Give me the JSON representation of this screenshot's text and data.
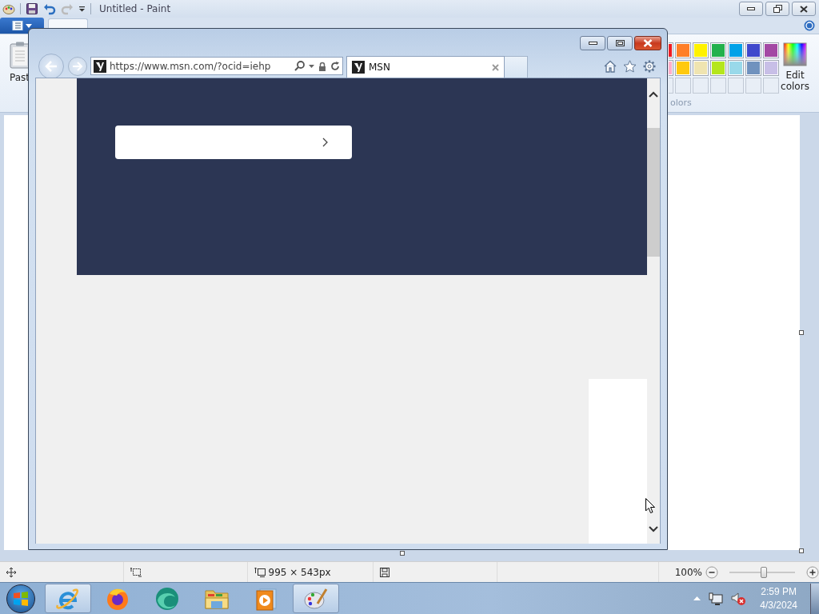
{
  "paint": {
    "title": "Untitled - Paint",
    "paste_label": "Past",
    "palette": [
      {
        "color": "#ed1c24"
      },
      {
        "color": "#ff7f27"
      },
      {
        "color": "#fff200"
      },
      {
        "color": "#22b14c"
      },
      {
        "color": "#00a2e8"
      },
      {
        "color": "#3f48cc"
      },
      {
        "color": "#a349a4"
      },
      {
        "color": "#ffaec9"
      },
      {
        "color": "#ffc90e"
      },
      {
        "color": "#efe4b0"
      },
      {
        "color": "#b5e61d"
      },
      {
        "color": "#99d9ea"
      },
      {
        "color": "#7092be"
      },
      {
        "color": "#c8bfe7"
      }
    ],
    "edit_colors": "Edit colors",
    "colors_label": "olors",
    "status": {
      "size": "995 × 543px",
      "zoom": "100%",
      "zoom_slider": {
        "level": 0.52
      }
    }
  },
  "browser": {
    "address": "https://www.msn.com/?ocid=iehp",
    "tab": {
      "title": "MSN"
    }
  },
  "taskbar": {
    "items": [
      {
        "kind": "ie",
        "running": true
      },
      {
        "kind": "firefox",
        "running": false
      },
      {
        "kind": "edge",
        "running": false
      },
      {
        "kind": "explorer",
        "running": false
      },
      {
        "kind": "media",
        "running": false
      },
      {
        "kind": "paint",
        "running": true
      }
    ],
    "clock": {
      "time": "2:59 PM",
      "date": "4/3/2024"
    }
  }
}
